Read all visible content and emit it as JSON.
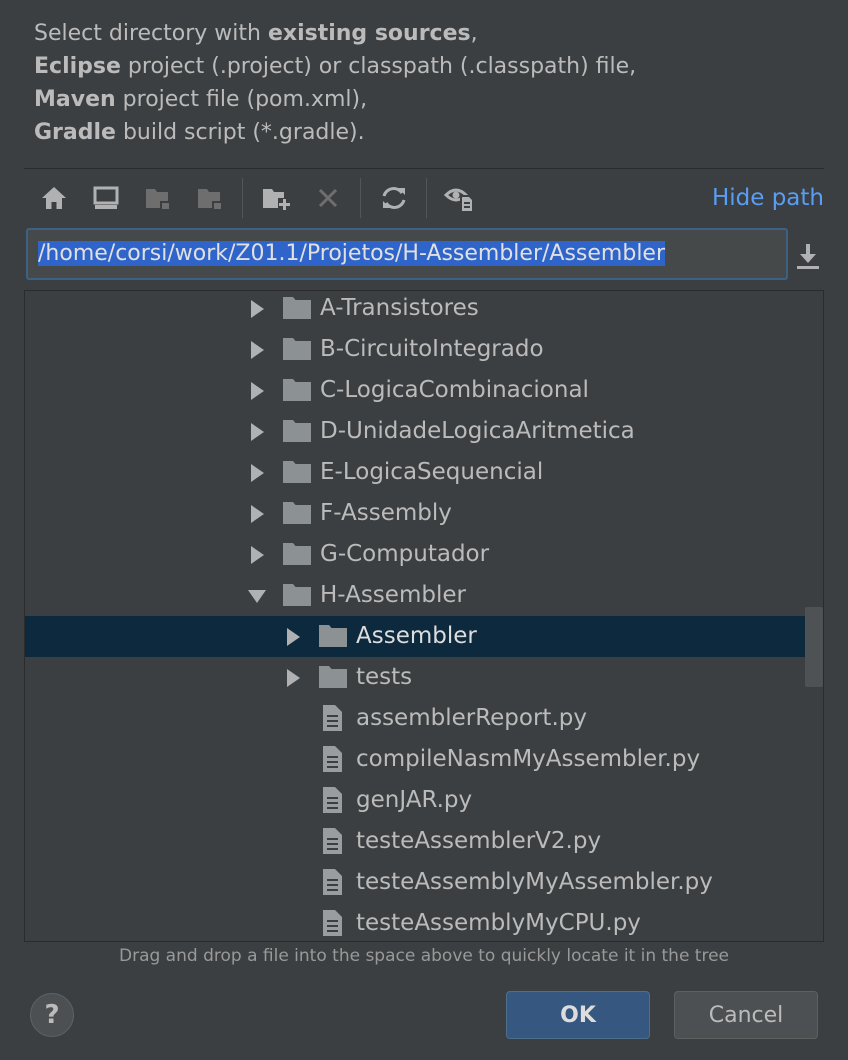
{
  "description": {
    "line1_pre": "Select directory with ",
    "line1_bold": "existing sources",
    "line1_post": ",",
    "line2_bold": "Eclipse",
    "line2_post": " project (.project) or classpath (.classpath) file,",
    "line3_bold": "Maven",
    "line3_post": " project file (pom.xml),",
    "line4_bold": "Gradle",
    "line4_post": " build script (*.gradle)."
  },
  "toolbar": {
    "hide_path_label": "Hide path",
    "buttons": [
      "home-icon",
      "desktop-icon",
      "project-folder-icon",
      "module-folder-icon",
      "new-folder-icon",
      "delete-icon",
      "refresh-icon",
      "show-hidden-icon"
    ]
  },
  "path": {
    "value": "/home/corsi/work/Z01.1/Projetos/H-Assembler/Assembler"
  },
  "tree": {
    "items": [
      {
        "label": "A-Transistores",
        "type": "folder",
        "expanded": false,
        "level": 0
      },
      {
        "label": "B-CircuitoIntegrado",
        "type": "folder",
        "expanded": false,
        "level": 0
      },
      {
        "label": "C-LogicaCombinacional",
        "type": "folder",
        "expanded": false,
        "level": 0
      },
      {
        "label": "D-UnidadeLogicaAritmetica",
        "type": "folder",
        "expanded": false,
        "level": 0
      },
      {
        "label": "E-LogicaSequencial",
        "type": "folder",
        "expanded": false,
        "level": 0
      },
      {
        "label": "F-Assembly",
        "type": "folder",
        "expanded": false,
        "level": 0
      },
      {
        "label": "G-Computador",
        "type": "folder",
        "expanded": false,
        "level": 0
      },
      {
        "label": "H-Assembler",
        "type": "folder",
        "expanded": true,
        "level": 0
      },
      {
        "label": "Assembler",
        "type": "folder",
        "expanded": false,
        "level": 1,
        "selected": true
      },
      {
        "label": "tests",
        "type": "folder",
        "expanded": false,
        "level": 1
      },
      {
        "label": "assemblerReport.py",
        "type": "file",
        "level": 1
      },
      {
        "label": "compileNasmMyAssembler.py",
        "type": "file",
        "level": 1
      },
      {
        "label": "genJAR.py",
        "type": "file",
        "level": 1
      },
      {
        "label": "testeAssemblerV2.py",
        "type": "file",
        "level": 1
      },
      {
        "label": "testeAssemblyMyAssembler.py",
        "type": "file",
        "level": 1
      },
      {
        "label": "testeAssemblyMyCPU.py",
        "type": "file",
        "level": 1
      }
    ]
  },
  "hint": "Drag and drop a file into the space above to quickly locate it in the tree",
  "footer": {
    "help_label": "?",
    "ok_label": "OK",
    "cancel_label": "Cancel"
  },
  "colors": {
    "background": "#3c3f41",
    "selection": "#0d293e",
    "accent_link": "#589df6",
    "ok_button": "#365880"
  }
}
